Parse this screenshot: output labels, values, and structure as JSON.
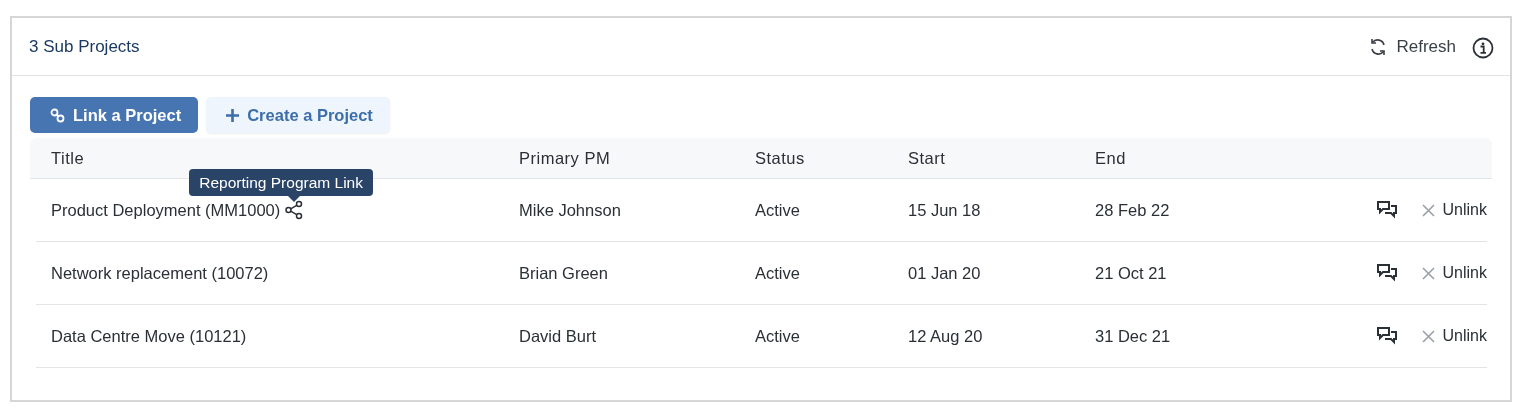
{
  "panel": {
    "title": "3 Sub Projects",
    "refresh": "Refresh"
  },
  "buttons": [
    {
      "kind": "primary",
      "label": "Link a Project"
    },
    {
      "kind": "light",
      "label": "Create a Project"
    }
  ],
  "table": {
    "columns": [
      "Title",
      "Primary PM",
      "Status",
      "Start",
      "End"
    ],
    "rows": [
      {
        "cells": [
          "Product Deployment (MM1000)",
          "Mike Johnson",
          "Active",
          "15 Jun 18",
          "28 Feb 22"
        ],
        "share_link": true,
        "tooltip": "Reporting Program Link",
        "action": "Unlink"
      },
      {
        "cells": [
          "Network replacement (10072)",
          "Brian Green",
          "Active",
          "01 Jan 20",
          "21 Oct 21"
        ],
        "share_link": false,
        "action": "Unlink"
      },
      {
        "cells": [
          "Data Centre Move (10121)",
          "David Burt",
          "Active",
          "12 Aug 20",
          "31 Dec 21"
        ],
        "share_link": false,
        "action": "Unlink"
      }
    ]
  }
}
